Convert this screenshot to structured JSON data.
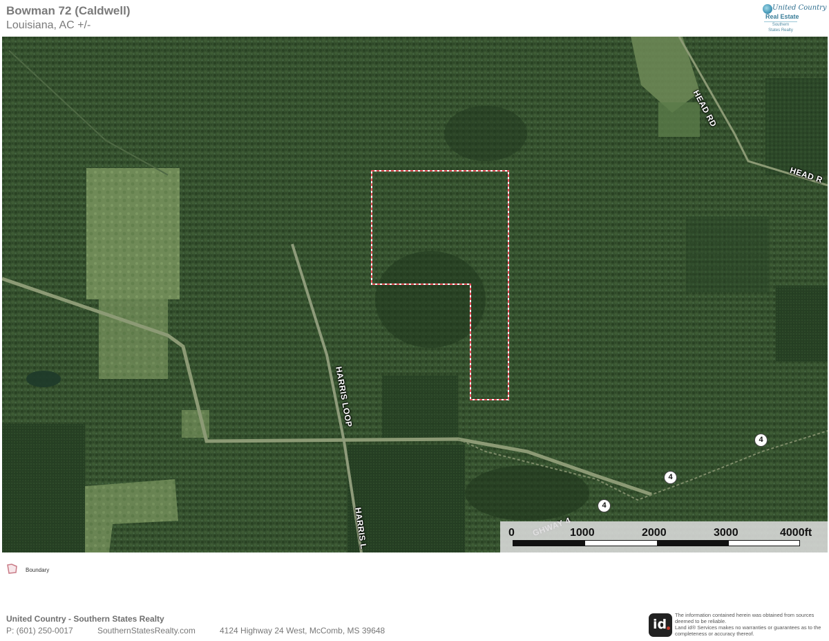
{
  "header": {
    "title": "Bowman 72 (Caldwell)",
    "subtitle": "Louisiana,  AC +/-"
  },
  "logo": {
    "brand_line1": "United Country",
    "brand_line2": "Real Estate",
    "office_line1": "Southern",
    "office_line2": "States Realty",
    "icon": "globe-icon"
  },
  "map": {
    "imagery": "satellite",
    "boundary_color": "#e8505b",
    "road_labels": {
      "head_rd_1": "HEAD RD",
      "head_rd_2": "HEAD R",
      "harris_loop_1": "HARRIS LOOP",
      "harris_loop_2": "HARRIS L",
      "highway": "GHWAY 4"
    },
    "route_shields": [
      "4",
      "4",
      "4"
    ]
  },
  "scale": {
    "labels": [
      "0",
      "1000",
      "2000",
      "3000",
      "4000ft"
    ]
  },
  "legend": {
    "items": [
      {
        "label": "Boundary",
        "color": "#c97a86"
      }
    ]
  },
  "footer": {
    "company": "United Country - Southern States Realty",
    "phone": "P: (601) 250-0017",
    "website": "SouthernStatesRealty.com",
    "address": "4124 Highway 24 West, McComb, MS 39648",
    "id_logo": "id",
    "disclaimer_1": "The information contained herein was obtained from sources deemed to be reliable.",
    "disclaimer_2": "Land id® Services makes no warranties or guarantees as to the completeness or accuracy thereof."
  }
}
